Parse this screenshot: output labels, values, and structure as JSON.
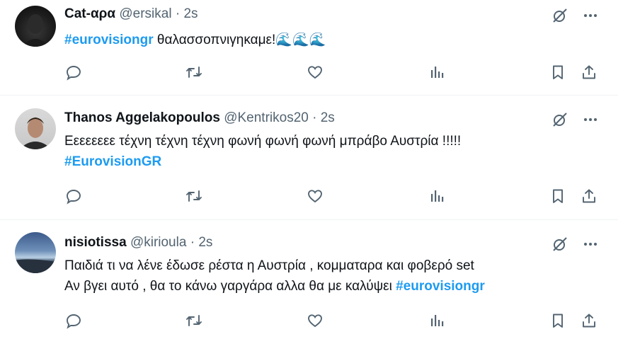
{
  "tweets": [
    {
      "name": "Cat-αρα",
      "handle": "@ersikal",
      "dot": "·",
      "time": "2s",
      "lines": [
        {
          "hashtag": "#eurovisiongr",
          "text": " θαλασσοπνιγηκαμε!",
          "emoji": "🌊🌊🌊"
        }
      ]
    },
    {
      "name": "Thanos Aggelakopoulos",
      "handle": "@Kentrikos20",
      "dot": "·",
      "time": "2s",
      "lines": [
        {
          "text": "Εεεεεεεε τέχνη τέχνη τέχνη φωνή φωνή φωνή μπράβο Αυστρία !!!!!"
        },
        {
          "hashtag": "#EurovisionGR"
        }
      ]
    },
    {
      "name": "nisiotissa",
      "handle": "@kirioula",
      "dot": "·",
      "time": "2s",
      "lines": [
        {
          "text": "Παιδιά τι να λένε έδωσε ρέστα η Αυστρία , κομματαρα και φοβερό set"
        },
        {
          "text": "Αν βγει αυτό , θα το κάνω γαργάρα αλλα θα με καλύψει  ",
          "hashtag": "#eurovisiongr"
        }
      ]
    }
  ],
  "icons": {
    "top": [
      "grok-icon",
      "more-icon"
    ],
    "actions": [
      "reply-icon",
      "retweet-icon",
      "like-icon",
      "views-icon",
      "bookmark-icon",
      "share-icon"
    ]
  },
  "colors": {
    "text": "#0f1419",
    "secondary": "#536471",
    "hashtag": "#1d9bf0",
    "divider": "#eff3f4"
  }
}
